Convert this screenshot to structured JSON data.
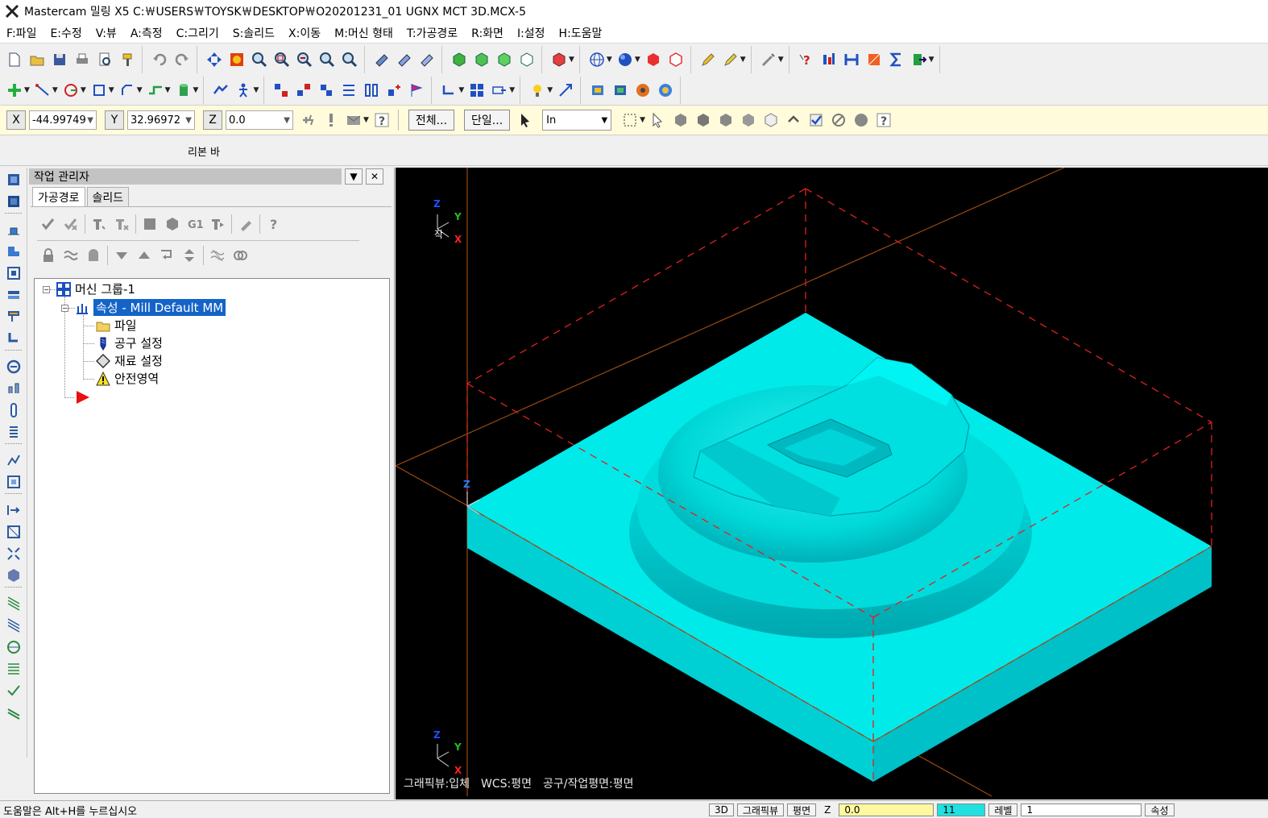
{
  "app": {
    "title": "Mastercam 밀링 X5   C:￦USERS￦TOYSK￦DESKTOP￦O20201231_01 UGNX MCT 3D.MCX-5"
  },
  "menu": [
    "F:파일",
    "E:수정",
    "V:뷰",
    "A:측정",
    "C:그리기",
    "S:솔리드",
    "X:이동",
    "M:머신 형태",
    "T:가공경로",
    "R:화면",
    "I:설정",
    "H:도움말"
  ],
  "coords": {
    "x_label": "X",
    "x_value": "-44.99749",
    "y_label": "Y",
    "y_value": "32.96972",
    "z_label": "Z",
    "z_value": "0.0"
  },
  "ribbon": {
    "all_button": "전체...",
    "single_button": "단일...",
    "mode_value": "In",
    "label": "리본 바"
  },
  "ops_manager": {
    "title": "작업 관리자",
    "tabs": [
      "가공경로",
      "솔리드"
    ],
    "tree": {
      "machine_group": "머신 그룹-1",
      "properties": "속성 - Mill Default MM",
      "files": "파일",
      "tool_settings": "공구 설정",
      "stock_settings": "재료 설정",
      "safety_zone": "안전영역"
    }
  },
  "viewport": {
    "status": {
      "graphics_view": "그래픽뷰:입체",
      "wcs": "WCS:평면",
      "tool_plane": "공구/작업평면:평면"
    },
    "axis_labels": {
      "z": "Z",
      "y": "Y",
      "x": "X"
    },
    "origin_mark": "작"
  },
  "statusbar": {
    "help_text": "도움말은 Alt+H를 누르십시오",
    "items": [
      "3D",
      "그래픽뷰",
      "평면",
      "Z",
      "0.0",
      "11",
      "레벨",
      "1",
      "속성"
    ]
  },
  "colors": {
    "part": "#00e5e5",
    "stock_box": "#e02020",
    "axis_lines": "#9a4a10",
    "selection": "#1464c8"
  }
}
